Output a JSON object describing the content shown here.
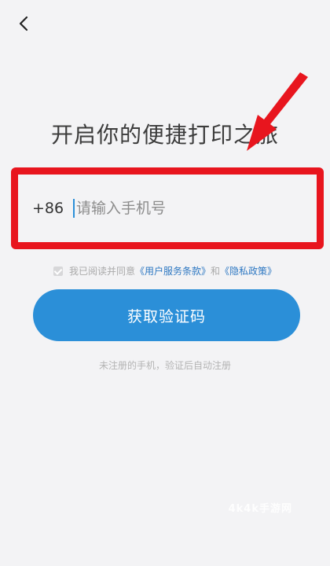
{
  "nav": {
    "back_icon": "chevron-left-icon"
  },
  "title": "开启你的便捷打印之旅",
  "phone": {
    "country_code": "+86",
    "placeholder": "请输入手机号",
    "value": ""
  },
  "agreement": {
    "prefix": "我已阅读并同意",
    "terms_link": "《用户服务条款》",
    "conjunction": "和",
    "privacy_link": "《隐私政策》",
    "checked": true
  },
  "actions": {
    "get_code_label": "获取验证码"
  },
  "hint": "未注册的手机，验证后自动注册",
  "watermark": "4k4k手游网",
  "colors": {
    "accent": "#2b8fd8",
    "highlight_red": "#e8151e",
    "link": "#2e78c2",
    "background": "#f3f3f5"
  },
  "annotations": {
    "arrow_icon": "red-arrow-icon",
    "highlight": "red-highlight-box"
  }
}
